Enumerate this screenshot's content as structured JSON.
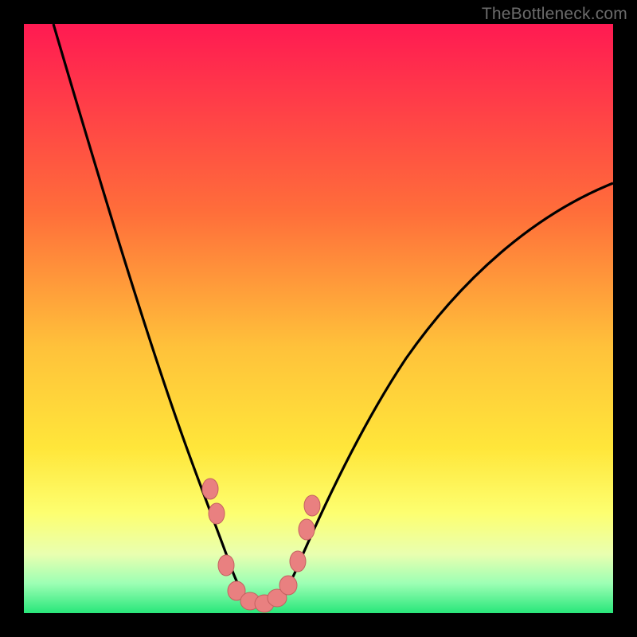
{
  "watermark": {
    "text": "TheBottleneck.com"
  },
  "colors": {
    "frame": "#000000",
    "gradient_top": "#ff1a52",
    "gradient_mid1": "#ff8a2b",
    "gradient_mid2": "#ffe63a",
    "gradient_mid3": "#f7ff73",
    "gradient_mid4": "#a3ff9e",
    "gradient_bottom": "#28e67a",
    "curve": "#000000",
    "marker_fill": "#e98080",
    "marker_stroke": "#c25858"
  },
  "chart_data": {
    "type": "line",
    "title": "",
    "xlabel": "",
    "ylabel": "",
    "xlim": [
      0,
      100
    ],
    "ylim": [
      0,
      100
    ],
    "series": [
      {
        "name": "bottleneck-curve",
        "x": [
          5,
          10,
          15,
          20,
          24,
          27,
          30,
          32,
          34,
          36,
          38,
          40,
          42,
          45,
          50,
          55,
          60,
          65,
          70,
          75,
          80,
          85,
          90,
          95,
          100
        ],
        "y": [
          100,
          88,
          75,
          62,
          48,
          38,
          27,
          18,
          10,
          5,
          2,
          1,
          2,
          5,
          14,
          24,
          33,
          41,
          48,
          54,
          59,
          63,
          67,
          70,
          72
        ]
      }
    ],
    "markers": [
      {
        "x": 31.5,
        "y": 21
      },
      {
        "x": 32.5,
        "y": 15
      },
      {
        "x": 34,
        "y": 7
      },
      {
        "x": 36,
        "y": 3
      },
      {
        "x": 38,
        "y": 1.5
      },
      {
        "x": 40,
        "y": 1
      },
      {
        "x": 42,
        "y": 1.5
      },
      {
        "x": 44,
        "y": 3
      },
      {
        "x": 46,
        "y": 8
      },
      {
        "x": 47.5,
        "y": 13
      },
      {
        "x": 48.5,
        "y": 18
      }
    ],
    "gradient_meaning": "vertical severity scale: top=red (high bottleneck), bottom=green (low bottleneck)"
  }
}
